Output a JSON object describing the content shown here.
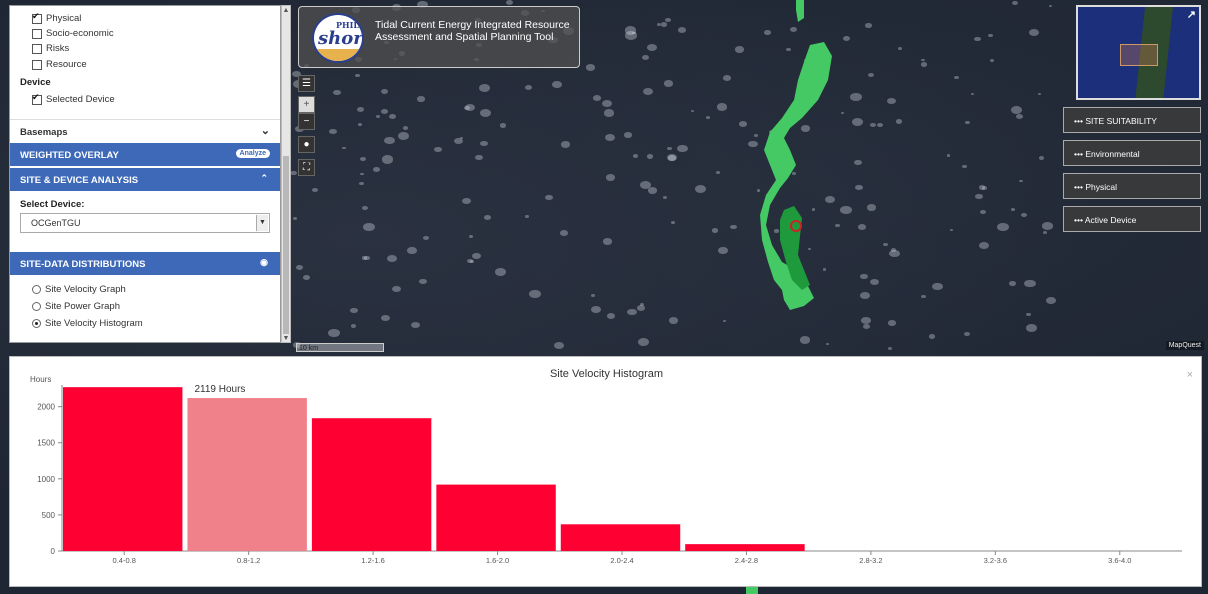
{
  "app": {
    "title": "Tidal Current Energy Integrated Resource Assessment and Spatial Planning Tool",
    "logo_top": "PHIL",
    "logo_main": "shore"
  },
  "layers": [
    {
      "label": "Physical",
      "checked": true
    },
    {
      "label": "Socio-economic",
      "checked": false
    },
    {
      "label": "Risks",
      "checked": false
    },
    {
      "label": "Resource",
      "checked": false
    }
  ],
  "device_section": {
    "heading": "Device",
    "selected_device_label": "Selected Device",
    "selected_device_checked": true
  },
  "basemaps": {
    "label": "Basemaps"
  },
  "weighted_overlay": {
    "label": "WEIGHTED OVERLAY",
    "button": "Analyze"
  },
  "site_device_analysis": {
    "label": "SITE & DEVICE ANALYSIS",
    "select_label": "Select Device:",
    "selected": "OCGenTGU"
  },
  "site_data_distributions": {
    "label": "SITE-DATA DISTRIBUTIONS",
    "options": [
      {
        "label": "Site Velocity Graph",
        "selected": false
      },
      {
        "label": "Site Power Graph",
        "selected": false
      },
      {
        "label": "Site Velocity Histogram",
        "selected": true
      }
    ]
  },
  "right_buttons": [
    {
      "label": "SITE SUITABILITY"
    },
    {
      "label": "Environmental"
    },
    {
      "label": "Physical"
    },
    {
      "label": "Active Device"
    }
  ],
  "map": {
    "scale": "10 km",
    "attribution": "MapQuest"
  },
  "icons": {
    "menu": "menu-icon",
    "zoom_in": "plus-icon",
    "zoom_out": "minus-icon",
    "locate": "globe-icon",
    "fullscreen": "fullscreen-icon",
    "expand": "expand-arrow-icon",
    "close": "close-icon",
    "eye": "eye-icon",
    "chevron": "chevron-icon"
  },
  "colors": {
    "bar": "#ff0033",
    "bar_highlight": "#f08089",
    "panel_blue": "#3d69b8",
    "suitability_green": "#44c964"
  },
  "chart_data": {
    "type": "bar",
    "title": "Site Velocity Histogram",
    "ylabel": "Hours",
    "xlabel": "",
    "categories": [
      "0.4-0.8",
      "0.8-1.2",
      "1.2-1.6",
      "1.6-2.0",
      "2.0-2.4",
      "2.4-2.8",
      "2.8-3.2",
      "3.2-3.6",
      "3.6-4.0"
    ],
    "values": [
      2270,
      2119,
      1840,
      920,
      370,
      95,
      0,
      0,
      0
    ],
    "highlight_index": 1,
    "tooltip": "2119 Hours",
    "ylim": [
      0,
      2300
    ],
    "yticks": [
      0,
      500,
      1000,
      1500,
      2000
    ]
  }
}
